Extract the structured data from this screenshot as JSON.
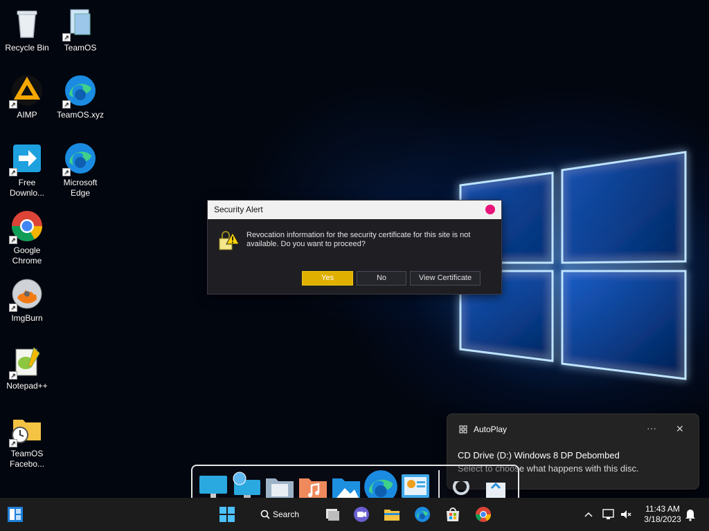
{
  "desktop": {
    "icons": [
      {
        "label": "Recycle Bin",
        "icon": "recycle-bin-icon"
      },
      {
        "label": "TeamOS",
        "icon": "teamos-shortcut-icon"
      },
      {
        "label": "AIMP",
        "icon": "aimp-icon"
      },
      {
        "label": "TeamOS.xyz",
        "icon": "edge-icon"
      },
      {
        "label": "Free Downlo...",
        "icon": "free-download-manager-icon"
      },
      {
        "label": "Microsoft Edge",
        "icon": "edge-icon"
      },
      {
        "label": "Google Chrome",
        "icon": "chrome-icon"
      },
      {
        "label": "ImgBurn",
        "icon": "imgburn-icon"
      },
      {
        "label": "Notepad++",
        "icon": "notepadpp-icon"
      },
      {
        "label": "TeamOS Facebo...",
        "icon": "folder-shortcut-icon"
      }
    ]
  },
  "dialog": {
    "title": "Security Alert",
    "message": "Revocation information for the security certificate for this site is not available. Do you want to proceed?",
    "buttons": {
      "yes": "Yes",
      "no": "No",
      "view": "View Certificate"
    },
    "accent": "#e0b000",
    "close_color": "#e8147a"
  },
  "toast": {
    "app": "AutoPlay",
    "more": "···",
    "close": "✕",
    "heading": "CD Drive (D:) Windows 8 DP Debombed",
    "body": "Select to choose what happens with this disc."
  },
  "taskbar": {
    "search_label": "Search",
    "time": "11:43 AM",
    "date": "3/18/2023",
    "chevron": "^"
  }
}
